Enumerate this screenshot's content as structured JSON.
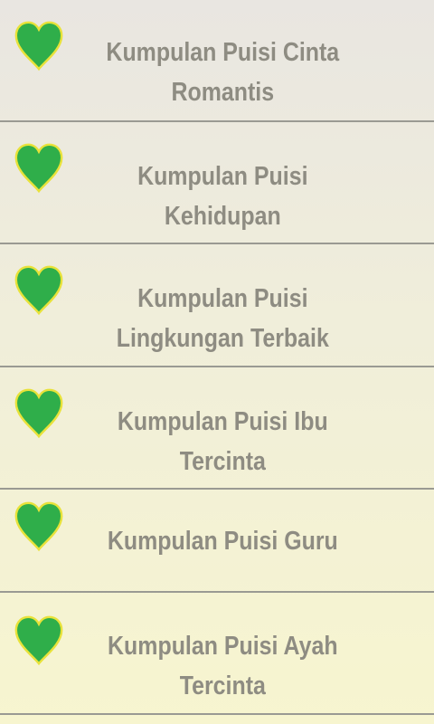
{
  "list": {
    "items": [
      {
        "label": "Kumpulan Puisi Cinta Romantis",
        "icon": "heart-icon"
      },
      {
        "label": "Kumpulan Puisi Kehidupan",
        "icon": "heart-icon"
      },
      {
        "label": "Kumpulan Puisi Lingkungan Terbaik",
        "icon": "heart-icon"
      },
      {
        "label": "Kumpulan Puisi Ibu Tercinta",
        "icon": "heart-icon"
      },
      {
        "label": "Kumpulan Puisi Guru",
        "icon": "heart-icon"
      },
      {
        "label": "Kumpulan Puisi Ayah Tercinta",
        "icon": "heart-icon"
      }
    ]
  },
  "colors": {
    "heart_fill": "#2fae4a",
    "heart_outline": "#e8e23a",
    "text": "#8e8c82",
    "divider": "#9a9a93"
  }
}
